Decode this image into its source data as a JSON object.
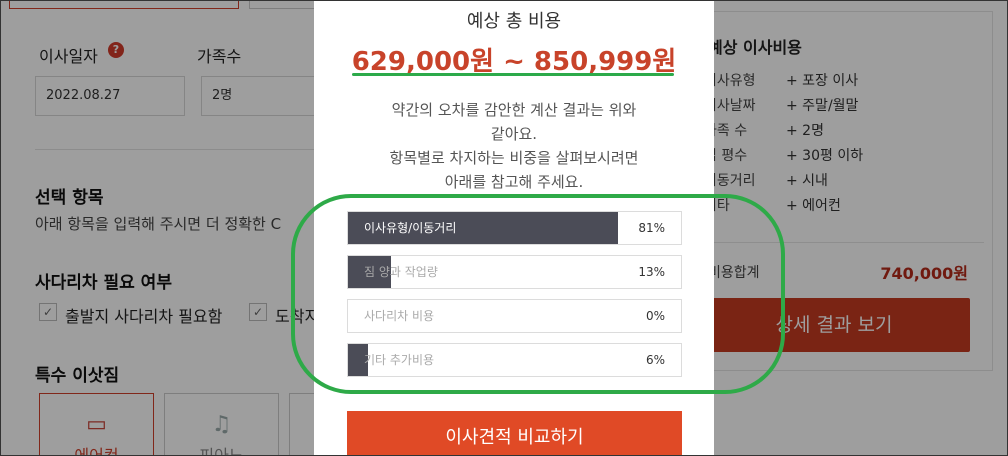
{
  "background": {
    "move_date_label": "이사일자",
    "help_icon_text": "?",
    "family_label": "가족수",
    "move_date_value": "2022.08.27",
    "family_value": "2명",
    "options_title": "선택 항목",
    "options_desc": "아래 항목을 입력해 주시면 더 정확한 C",
    "ladder_title": "사다리차 필요 여부",
    "ladder_origin": "출발지 사다리차 필요함",
    "ladder_dest_partial": "도착지",
    "special_title": "특수 이삿짐",
    "special_items": [
      {
        "label": "에어컨"
      },
      {
        "label": "피아노"
      }
    ]
  },
  "summary_panel": {
    "title": "예상 이사비용",
    "rows": [
      {
        "key": "이사유형",
        "value": "+ 포장 이사"
      },
      {
        "key": "이사날짜",
        "value": "+ 주말/월말"
      },
      {
        "key": "가족 수",
        "value": "+ 2명"
      },
      {
        "key": "집 평수",
        "value": "+ 30평 이하"
      },
      {
        "key": "이동거리",
        "value": "+ 시내"
      },
      {
        "key": "기타",
        "value": "+ 에어컨"
      }
    ],
    "total_label": "비용합계",
    "total_value": "740,000원",
    "detail_button": "상세 결과 보기"
  },
  "modal": {
    "title": "예상 총 비용",
    "range": "629,000원 ~ 850,999원",
    "note_lines": [
      "약간의 오차를 감안한 계산 결과는 위와",
      "같아요.",
      "항목별로 차지하는 비중을 살펴보시려면",
      "아래를 참고해 주세요."
    ],
    "breakdown": [
      {
        "label": "이사유형/이동거리",
        "percent": 81,
        "percent_text": "81%"
      },
      {
        "label": "짐 양과 작업량",
        "percent": 13,
        "percent_text": "13%"
      },
      {
        "label": "사다리차 비용",
        "percent": 0,
        "percent_text": "0%"
      },
      {
        "label": "기타 추가비용",
        "percent": 6,
        "percent_text": "6%"
      }
    ],
    "cta": "이사견적 비교하기"
  },
  "colors": {
    "accent_red": "#c8432a",
    "bar_fill": "#4b4c57",
    "highlight_green": "#2eaa48"
  }
}
